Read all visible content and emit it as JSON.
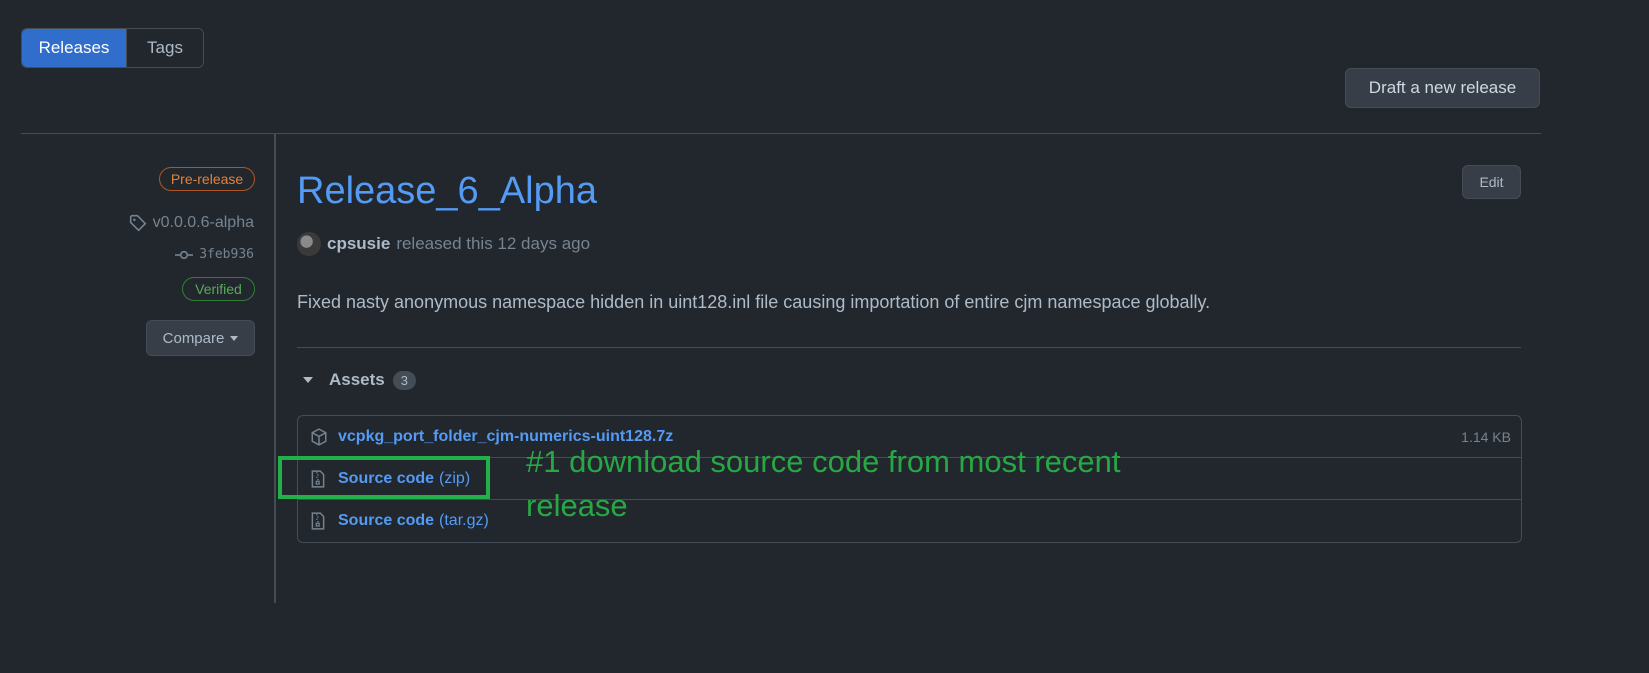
{
  "tabs": [
    {
      "label": "Releases",
      "active": true
    },
    {
      "label": "Tags",
      "active": false
    }
  ],
  "draft_button": "Draft a new release",
  "sidebar": {
    "prerelease_badge": "Pre-release",
    "tag": "v0.0.0.6-alpha",
    "commit": "3feb936",
    "verified_badge": "Verified",
    "compare_button": "Compare"
  },
  "release": {
    "title": "Release_6_Alpha",
    "edit_button": "Edit",
    "author": "cpsusie",
    "released_text": "released this 12 days ago",
    "description": "Fixed nasty anonymous namespace hidden in uint128.inl file causing importation of entire cjm namespace globally."
  },
  "assets": {
    "label": "Assets",
    "count": "3",
    "items": [
      {
        "name": "vcpkg_port_folder_cjm-numerics-uint128.7z",
        "suffix": "",
        "size": "1.14 KB",
        "icon": "package-icon"
      },
      {
        "name": "Source code",
        "suffix": "(zip)",
        "size": "",
        "icon": "file-zip-icon"
      },
      {
        "name": "Source code",
        "suffix": "(tar.gz)",
        "size": "",
        "icon": "file-zip-icon"
      }
    ]
  },
  "annotation": "#1 download source code from most recent release",
  "colors": {
    "background": "#22272e",
    "accent": "#539bf5",
    "annotation": "#28a745",
    "prerelease": "#e0823d",
    "verified": "#57ab5a"
  }
}
